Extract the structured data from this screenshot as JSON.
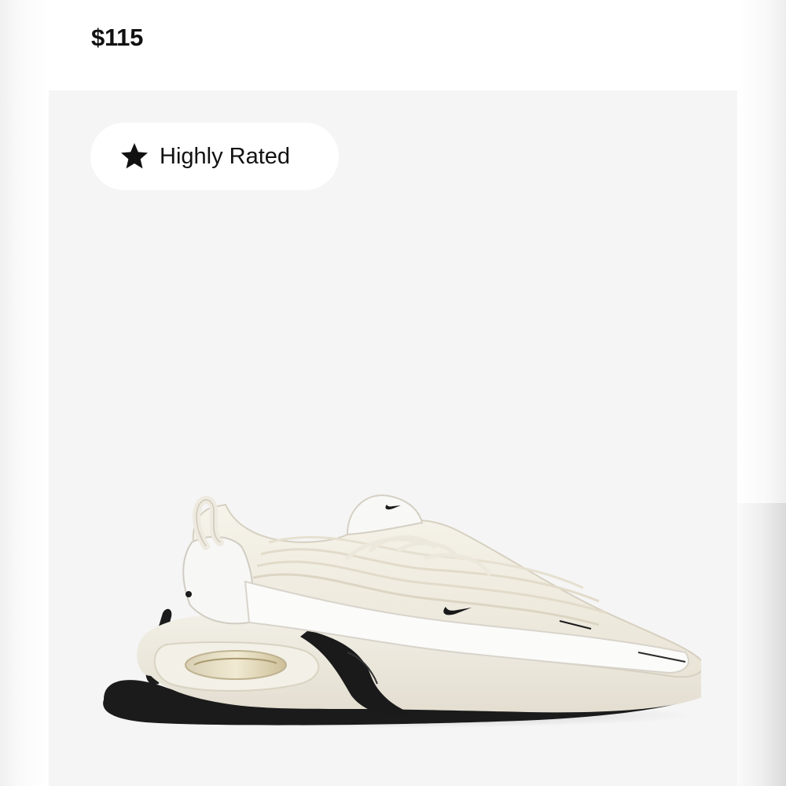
{
  "product": {
    "price": "$115",
    "badge": {
      "label": "Highly Rated",
      "icon": "star-icon"
    },
    "image": {
      "subject": "sneaker"
    }
  },
  "colors": {
    "background": "#ffffff",
    "image_background": "#f5f5f5",
    "text": "#111111",
    "shoe_upper": "#efebe0",
    "shoe_sole": "#ece8dc",
    "shoe_outsole": "#1a1a1a"
  }
}
